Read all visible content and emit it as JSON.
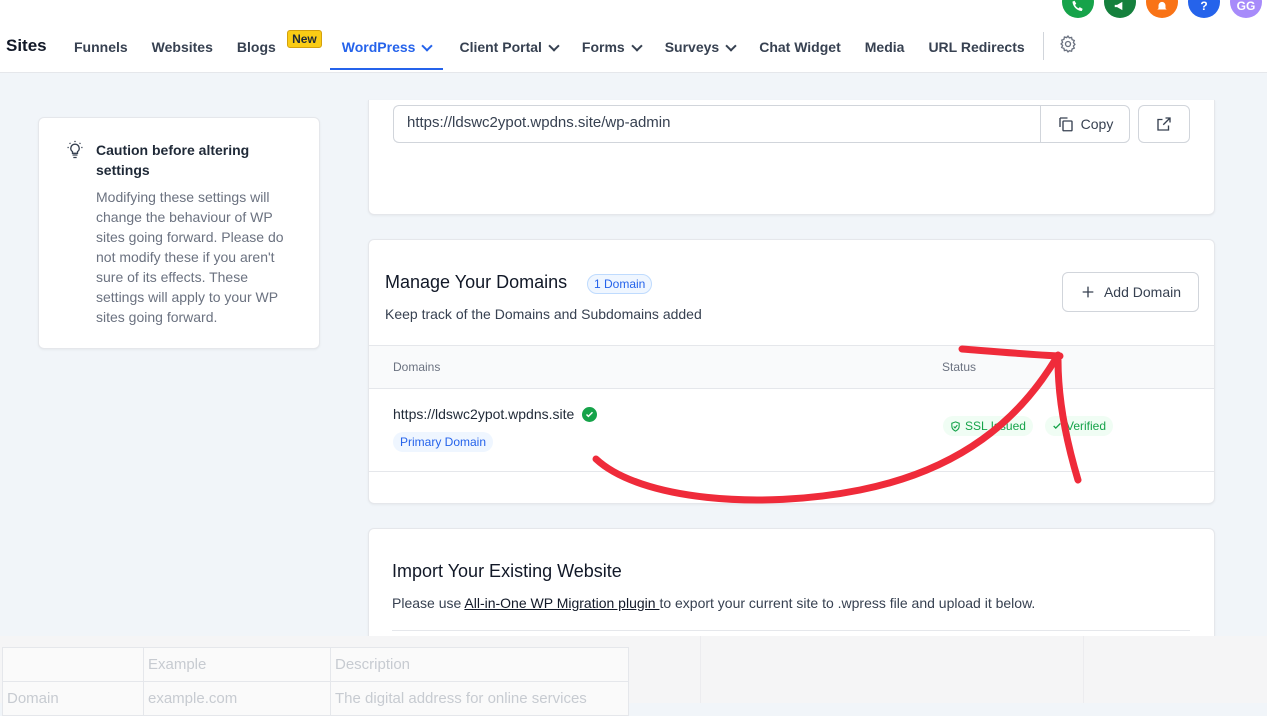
{
  "header": {
    "brand": "Sites",
    "nav": {
      "funnels": "Funnels",
      "websites": "Websites",
      "blogs": "Blogs",
      "blogs_badge": "New",
      "wordpress": "WordPress",
      "client_portal": "Client Portal",
      "forms": "Forms",
      "surveys": "Surveys",
      "chat_widget": "Chat Widget",
      "media": "Media",
      "url_redirects": "URL Redirects"
    },
    "avatar_initials": "GG",
    "help_glyph": "?"
  },
  "caution": {
    "title": "Caution before altering settings",
    "body": "Modifying these settings will change the behaviour of WP sites going forward. Please do not modify these if you aren't sure of its effects. These settings will apply to your WP sites going forward."
  },
  "admin": {
    "url": "https://ldswc2ypot.wpdns.site/wp-admin",
    "copy_label": "Copy"
  },
  "domains": {
    "title": "Manage Your Domains",
    "count_badge": "1 Domain",
    "subtitle": "Keep track of the Domains and Subdomains added",
    "add_label": "Add Domain",
    "col_domains": "Domains",
    "col_status": "Status",
    "rows": [
      {
        "url": "https://ldswc2ypot.wpdns.site",
        "primary_badge": "Primary Domain",
        "ssl_status": "SSL Issued",
        "verify_status": "Verified"
      }
    ]
  },
  "import": {
    "title": "Import Your Existing Website",
    "text_before": "Please use ",
    "link_text": "All-in-One WP Migration plugin ",
    "text_after": "to export your current site to .wpress file and upload it below."
  },
  "overlay_table": {
    "header": [
      "",
      "Example",
      "Description"
    ],
    "row": [
      "Domain",
      "example.com",
      "The digital address for online services"
    ]
  },
  "colors": {
    "accent": "#2563eb",
    "success": "#16a34a",
    "arrow": "#ef2b3a",
    "badge_new": "#facc15"
  }
}
